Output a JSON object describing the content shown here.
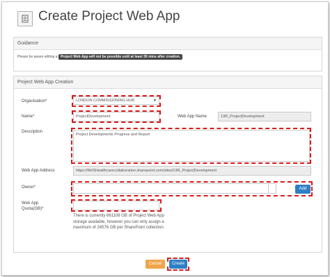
{
  "page": {
    "title": "Create Project Web App"
  },
  "guidance": {
    "header": "Guidance",
    "text_before": "Please be aware editing a",
    "highlight": "Project Web App will not be possible until at least 30 mins after creation."
  },
  "form": {
    "header": "Project Web App Creation",
    "organisation": {
      "label": "Organisation*",
      "value": "LONDON COMMISSIONING HUB"
    },
    "name": {
      "label": "Name*",
      "value": "ProjectDevelopment"
    },
    "web_app_name": {
      "label": "Web App Name",
      "value": "13R_ProjectDevelopment"
    },
    "description": {
      "label": "Description",
      "value": "Project Developments Progress and Report"
    },
    "web_app_address": {
      "label": "Web App Address",
      "value": "https://NHSHealthcarecollaboration.sharepoint.com/sites/13R_ProjectDevelopment"
    },
    "owner": {
      "label": "Owner*",
      "value": "",
      "add_label": "Add"
    },
    "quota": {
      "label_line1": "Web App",
      "label_line2": "Quota(GB)*",
      "value": "",
      "help": "There is currently 661108 GB of Project Web App storage available, however you can only assign a maximum of 24576 GB per SharePoint collection."
    }
  },
  "actions": {
    "cancel_label": "Cancel",
    "create_label": "Create"
  },
  "colors": {
    "highlight_dash": "#d91a1a",
    "add_button": "#2f7fc4",
    "cancel_button": "#f0a44a",
    "create_button": "#2f7fc4"
  }
}
